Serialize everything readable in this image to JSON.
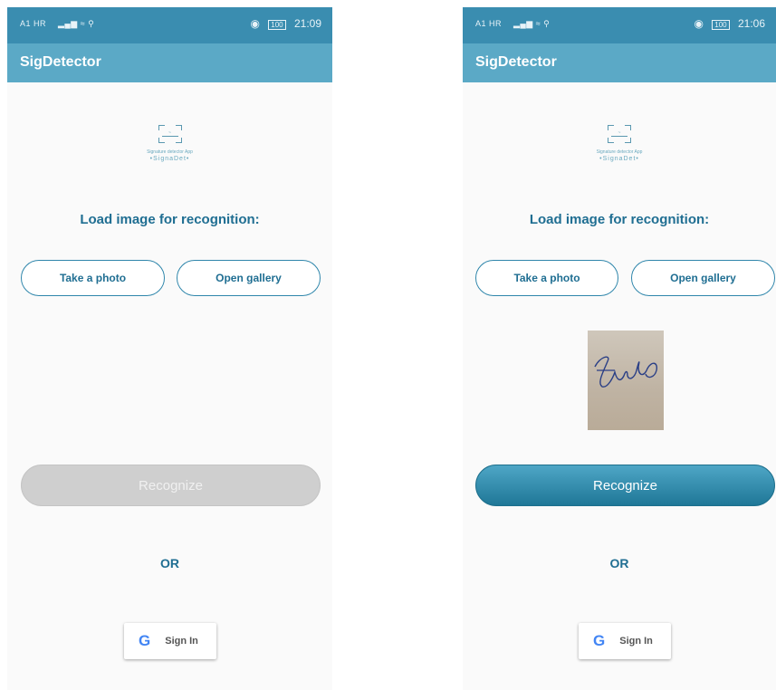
{
  "screens": [
    {
      "status_bar": {
        "carrier": "A1 HR",
        "time": "21:09",
        "battery": "100"
      },
      "app_title": "SigDetector",
      "logo": {
        "tagline": "Signature detector App",
        "name": "•SignaDet•"
      },
      "heading": "Load image for recognition:",
      "take_photo_label": "Take a photo",
      "open_gallery_label": "Open gallery",
      "recognize_label": "Recognize",
      "recognize_enabled": false,
      "or_label": "OR",
      "signin_label": "Sign In",
      "google_icon": "G"
    },
    {
      "status_bar": {
        "carrier": "A1 HR",
        "time": "21:06",
        "battery": "100"
      },
      "app_title": "SigDetector",
      "logo": {
        "tagline": "Signature detector App",
        "name": "•SignaDet•"
      },
      "heading": "Load image for recognition:",
      "take_photo_label": "Take a photo",
      "open_gallery_label": "Open gallery",
      "selected_image": "signature-photo",
      "recognize_label": "Recognize",
      "recognize_enabled": true,
      "or_label": "OR",
      "signin_label": "Sign In",
      "google_icon": "G"
    }
  ],
  "colors": {
    "status_bar": "#3a8db0",
    "app_bar": "#5ba9c6",
    "accent": "#1f6e92",
    "disabled": "#cfcfcf"
  }
}
